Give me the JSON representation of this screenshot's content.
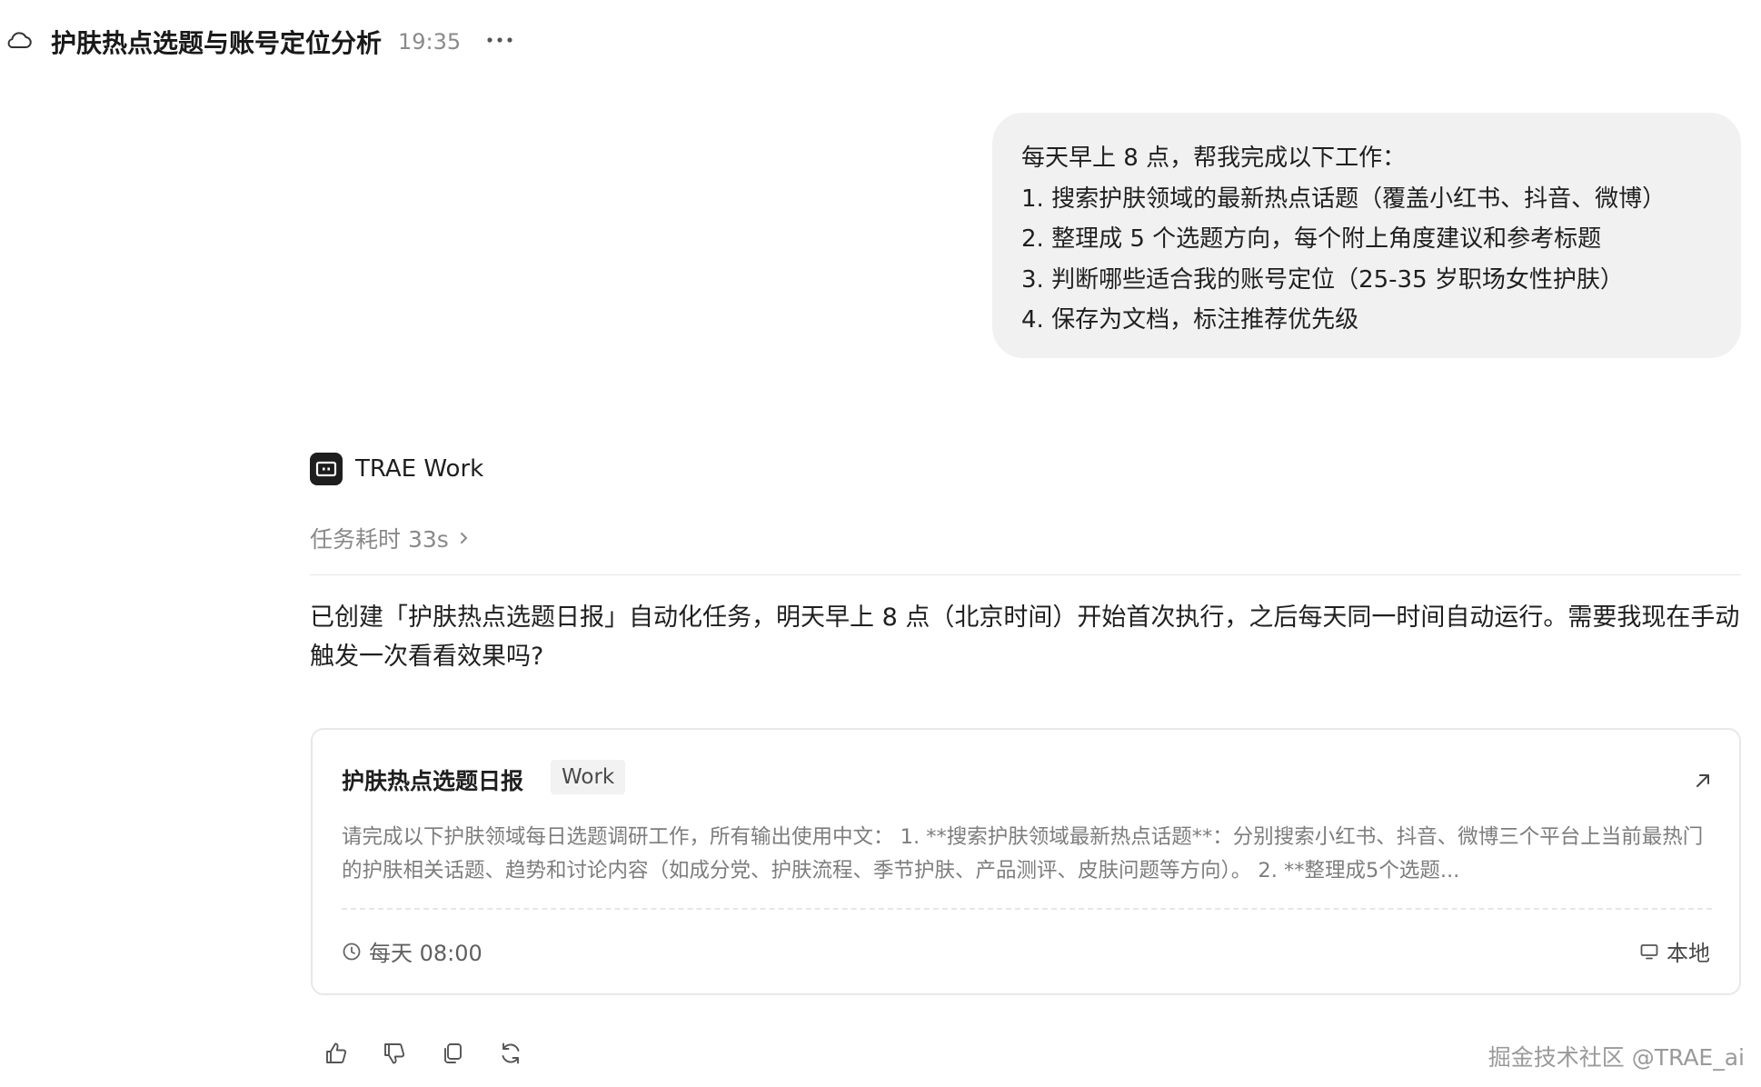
{
  "header": {
    "title": "护肤热点选题与账号定位分析",
    "time": "19:35"
  },
  "user_message": {
    "lines": [
      "每天早上 8 点，帮我完成以下工作：",
      "1. 搜索护肤领域的最新热点话题（覆盖小红书、抖音、微博）",
      "2. 整理成 5 个选题方向，每个附上角度建议和参考标题",
      "3. 判断哪些适合我的账号定位（25-35 岁职场女性护肤）",
      "4. 保存为文档，标注推荐优先级"
    ]
  },
  "agent": {
    "name": "TRAE Work",
    "task_time": "任务耗时 33s",
    "reply": "已创建「护肤热点选题日报」自动化任务，明天早上 8 点（北京时间）开始首次执行，之后每天同一时间自动运行。需要我现在手动触发一次看看效果吗?"
  },
  "task_card": {
    "title": "护肤热点选题日报",
    "tag": "Work",
    "description": "请完成以下护肤领域每日选题调研工作，所有输出使用中文： 1. **搜索护肤领域最新热点话题**：分别搜索小红书、抖音、微博三个平台上当前最热门的护肤相关话题、趋势和讨论内容（如成分党、护肤流程、季节护肤、产品测评、皮肤问题等方向）。 2. **整理成5个选题...",
    "schedule": "每天 08:00",
    "location": "本地"
  },
  "actions": {
    "icons": [
      "thumbs-up-icon",
      "thumbs-down-icon",
      "copy-icon",
      "regenerate-icon"
    ]
  },
  "watermark": "掘金技术社区 @TRAE_ai"
}
